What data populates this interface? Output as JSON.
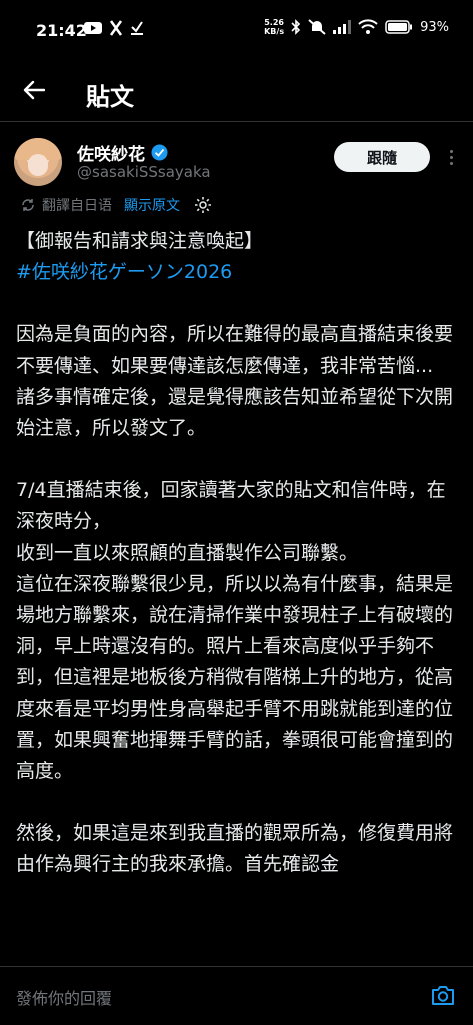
{
  "status_bar": {
    "time": "21:42",
    "net_speed_value": "5.26",
    "net_speed_unit": "KB/s",
    "battery": "93%"
  },
  "header": {
    "title": "貼文"
  },
  "author": {
    "name": "佐咲紗花",
    "handle": "@sasakiSSsayaka",
    "verified": true,
    "follow_label": "跟隨"
  },
  "translate": {
    "label": "翻譯自日语",
    "show_original": "顯示原文"
  },
  "post": {
    "line_title": "【御報告和請求與注意喚起】",
    "hashtag": "#佐咲紗花ゲーソン2026",
    "para1": "因為是負面的內容，所以在難得的最高直播結束後要不要傳達、如果要傳達該怎麼傳達，我非常苦惱...",
    "para2": "諸多事情確定後，還是覺得應該告知並希望從下次開始注意，所以發文了。",
    "para3": "7/4直播結束後，回家讀著大家的貼文和信件時，在深夜時分，",
    "para4": "收到一直以來照顧的直播製作公司聯繫。",
    "para5": "這位在深夜聯繫很少見，所以以為有什麼事，結果是場地方聯繫來，說在清掃作業中發現柱子上有破壞的洞，早上時還沒有的。照片上看來高度似乎手夠不到，但這裡是地板後方稍微有階梯上升的地方，從高度來看是平均男性身高舉起手臂不用跳就能到達的位置，如果興奮地揮舞手臂的話，拳頭很可能會撞到的高度。",
    "para6": "然後，如果這是來到我直播的觀眾所為，修復費用將由作為興行主的我來承擔。首先確認金"
  },
  "reply": {
    "placeholder": "發佈你的回覆"
  },
  "colors": {
    "accent": "#1d9bf0",
    "background": "#000000",
    "muted": "#71767b"
  }
}
